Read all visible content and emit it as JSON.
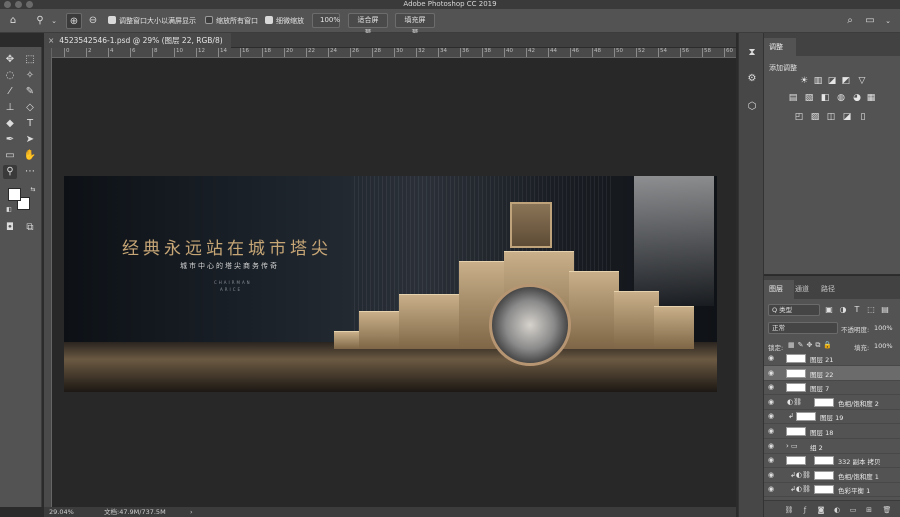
{
  "app": {
    "title": "Adobe Photoshop CC 2019"
  },
  "options_bar": {
    "resize_windows_label": "调整窗口大小以满屏显示",
    "zoom_all_windows_label": "缩放所有窗口",
    "scrubby_zoom_label": "细微缩放",
    "zoom_value_button": "100%",
    "fit_screen_button": "适合屏幕",
    "fill_screen_button": "填充屏幕",
    "resize_windows_checked": true,
    "zoom_all_windows_checked": false,
    "scrubby_zoom_checked": true
  },
  "document": {
    "tab_title": "4523542546-1.psd @ 29% (图层 22, RGB/8)",
    "close_glyph": "×"
  },
  "ruler": {
    "h_ticks": [
      "0",
      "2",
      "4",
      "6",
      "8",
      "10",
      "12",
      "14",
      "16",
      "18",
      "20",
      "22",
      "24",
      "26",
      "28",
      "30",
      "32",
      "34",
      "36",
      "38",
      "40",
      "42",
      "44",
      "46",
      "48",
      "50",
      "52",
      "54",
      "56",
      "58",
      "60"
    ]
  },
  "artwork": {
    "headline": "经典永远站在城市塔尖",
    "subline": "城市中心的塔尖商务传奇",
    "brand_line_1": "CHAIRMAN",
    "brand_line_2": "ARICE"
  },
  "status": {
    "zoom": "29.04%",
    "doc_size": "文档:47.9M/737.5M",
    "arrow": "›"
  },
  "adjustments_panel": {
    "tab_label": "调整",
    "add_label": "添加调整",
    "icons": [
      "☀",
      "▥",
      "◪",
      "◩",
      "▽",
      "▤",
      "▧",
      "◧",
      "◍",
      "◕",
      "▦",
      "◰",
      "▨",
      "◫",
      "◪",
      "▯"
    ]
  },
  "layers_panel": {
    "tabs": [
      "图层",
      "通道",
      "路径"
    ],
    "filter_kind": "Q 类型",
    "blend_mode": "正常",
    "opacity_label": "不透明度:",
    "opacity_value": "100%",
    "lock_label": "锁定:",
    "fill_label": "填充:",
    "fill_value": "100%",
    "layers": [
      {
        "name": "图层 21",
        "type": "pixel",
        "selected": false
      },
      {
        "name": "图层 22",
        "type": "pixel",
        "selected": true
      },
      {
        "name": "图层 7",
        "type": "pixel",
        "selected": false
      },
      {
        "name": "色相/饱和度 2",
        "type": "adjustment",
        "selected": false
      },
      {
        "name": "图层 19",
        "type": "pixel-clipped",
        "selected": false
      },
      {
        "name": "图层 18",
        "type": "pixel",
        "selected": false
      },
      {
        "name": "组 2",
        "type": "group",
        "selected": false
      },
      {
        "name": "332 副本 拷贝",
        "type": "masked",
        "selected": false
      },
      {
        "name": "色相/饱和度 1",
        "type": "adjustment-clipped",
        "selected": false
      },
      {
        "name": "色彩平衡 1",
        "type": "adjustment-clipped",
        "selected": false
      }
    ]
  },
  "colors": {
    "accent_gold": "#c7a676",
    "panel_bg": "#535353",
    "canvas_bg": "#282828"
  }
}
